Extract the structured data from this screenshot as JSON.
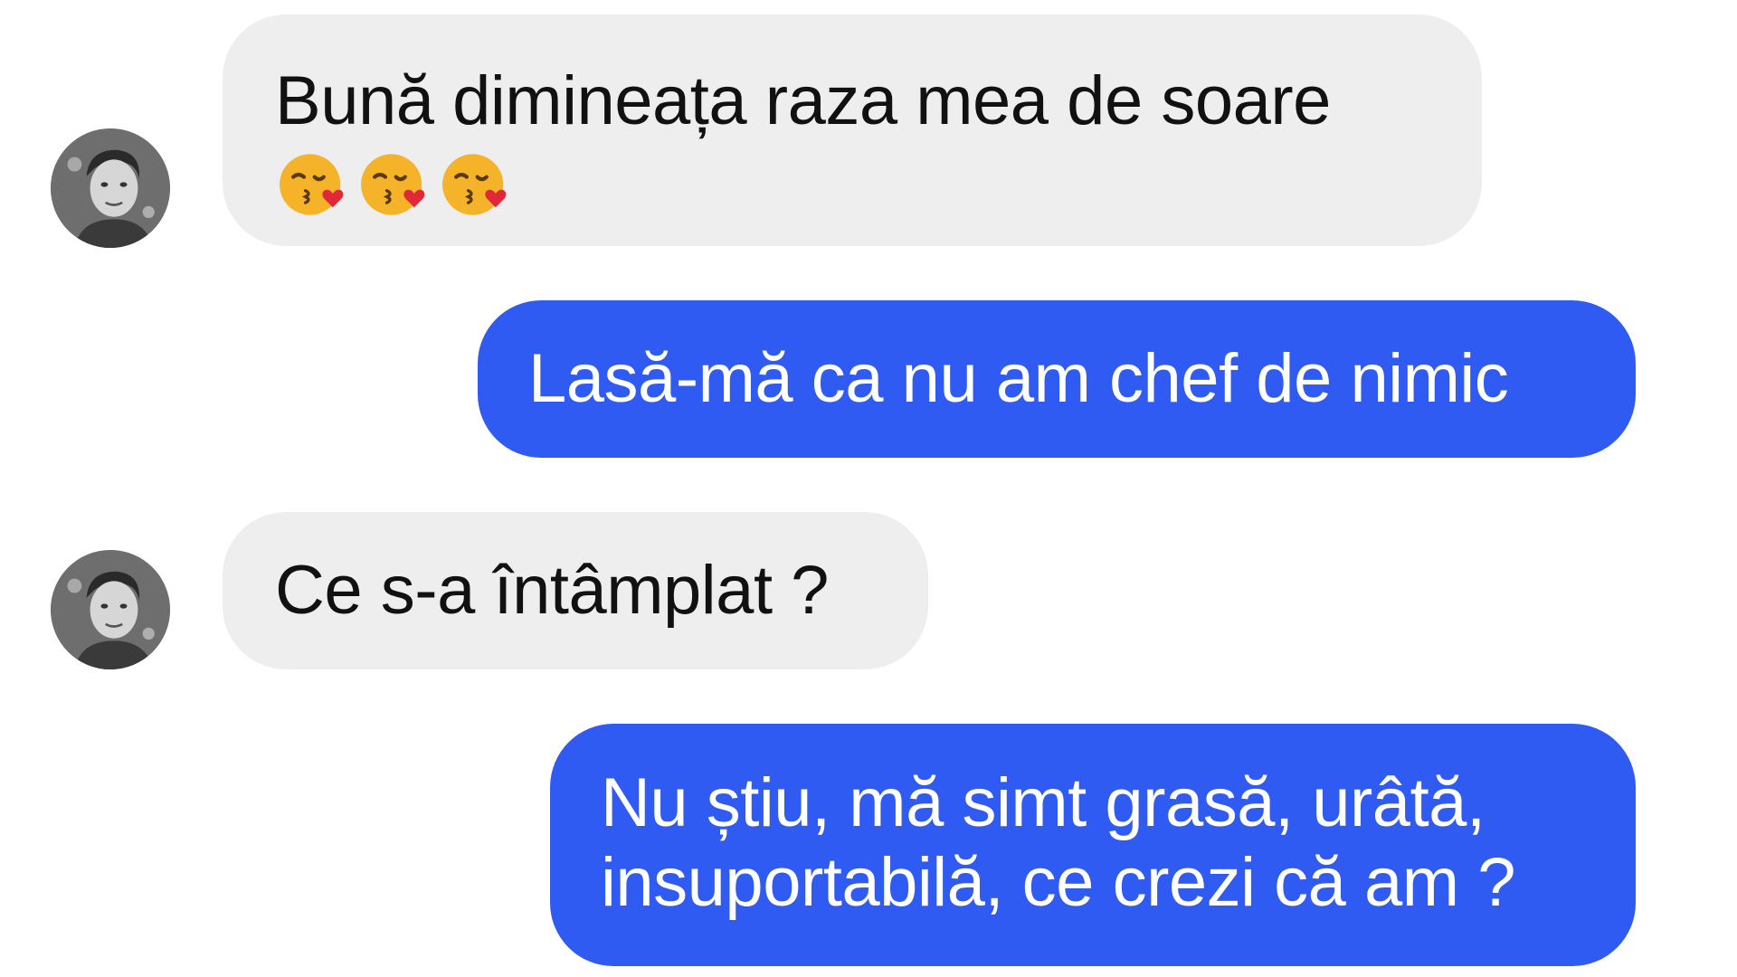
{
  "conversation": {
    "messages": [
      {
        "sender": "contact",
        "lines": [
          "Bună dimineața raza mea de soare"
        ],
        "emojis": [
          "kissing-face-with-heart-icon",
          "kissing-face-with-heart-icon",
          "kissing-face-with-heart-icon"
        ]
      },
      {
        "sender": "me",
        "lines": [
          "Lasă-mă ca nu am chef de nimic"
        ]
      },
      {
        "sender": "contact",
        "lines": [
          "Ce s-a întâmplat  ?"
        ]
      },
      {
        "sender": "me",
        "lines": [
          "Nu știu, mă simt grasă, urâtă,",
          "insuportabilă, ce crezi că am ?"
        ]
      }
    ]
  },
  "colors": {
    "incoming_bubble": "#eeeeee",
    "outgoing_bubble": "#2f5bf2",
    "incoming_text": "#111111",
    "outgoing_text": "#ffffff"
  }
}
